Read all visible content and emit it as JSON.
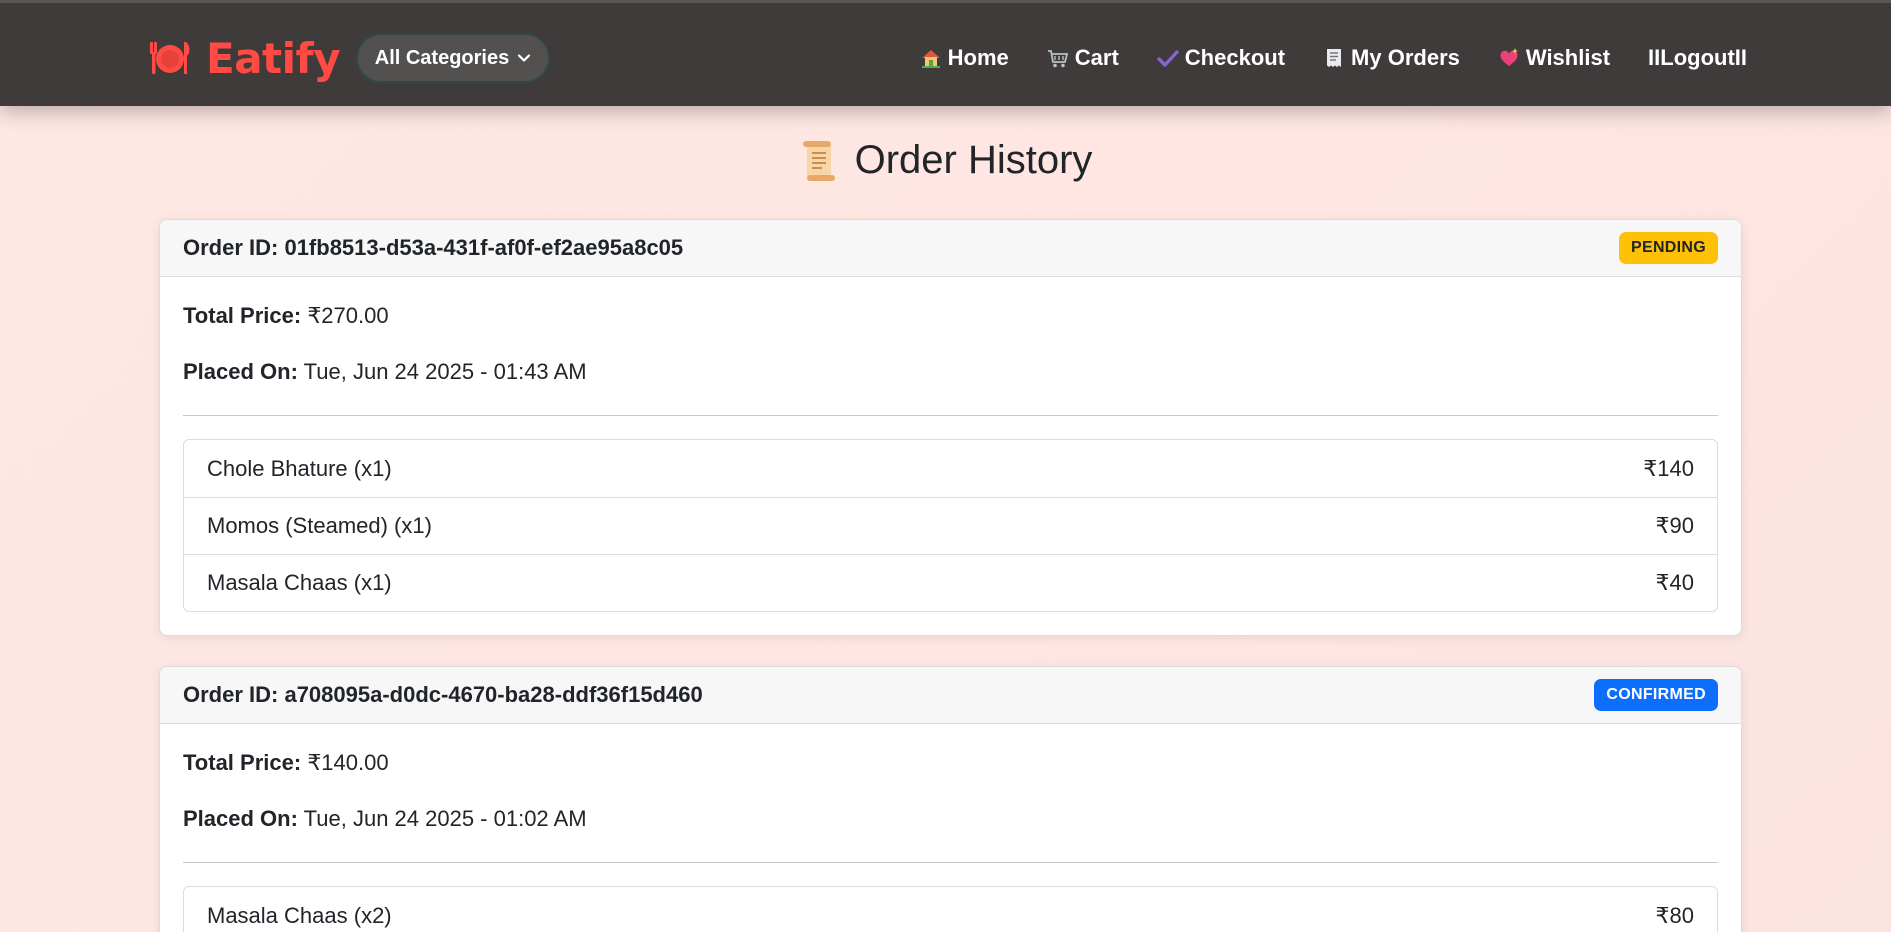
{
  "brand": {
    "name": "Eatify",
    "icon": "plate-cutlery-icon",
    "color": "#ff4b44"
  },
  "categories_button": {
    "label": "All Categories"
  },
  "nav": {
    "items": [
      {
        "label": "Home",
        "icon": "house-icon"
      },
      {
        "label": "Cart",
        "icon": "cart-icon"
      },
      {
        "label": "Checkout",
        "icon": "checkmark-icon"
      },
      {
        "label": "My Orders",
        "icon": "receipt-icon"
      },
      {
        "label": "Wishlist",
        "icon": "sparkling-heart-icon"
      },
      {
        "label": "IILogoutII"
      }
    ]
  },
  "page": {
    "title": "Order History",
    "icon": "scroll-icon"
  },
  "orders": [
    {
      "id_label": "Order ID: 01fb8513-d53a-431f-af0f-ef2ae95a8c05",
      "status": "PENDING",
      "status_color": "#ffc107",
      "total_label": "Total Price:",
      "total_value": "₹270.00",
      "placed_label": "Placed On:",
      "placed_value": "Tue, Jun 24 2025 - 01:43 AM",
      "items": [
        {
          "name": "Chole Bhature (x1)",
          "price": "₹140"
        },
        {
          "name": "Momos (Steamed) (x1)",
          "price": "₹90"
        },
        {
          "name": "Masala Chaas (x1)",
          "price": "₹40"
        }
      ]
    },
    {
      "id_label": "Order ID: a708095a-d0dc-4670-ba28-ddf36f15d460",
      "status": "CONFIRMED",
      "status_color": "#0d6efd",
      "total_label": "Total Price:",
      "total_value": "₹140.00",
      "placed_label": "Placed On:",
      "placed_value": "Tue, Jun 24 2025 - 01:02 AM",
      "items": [
        {
          "name": "Masala Chaas (x2)",
          "price": "₹80"
        }
      ]
    }
  ]
}
